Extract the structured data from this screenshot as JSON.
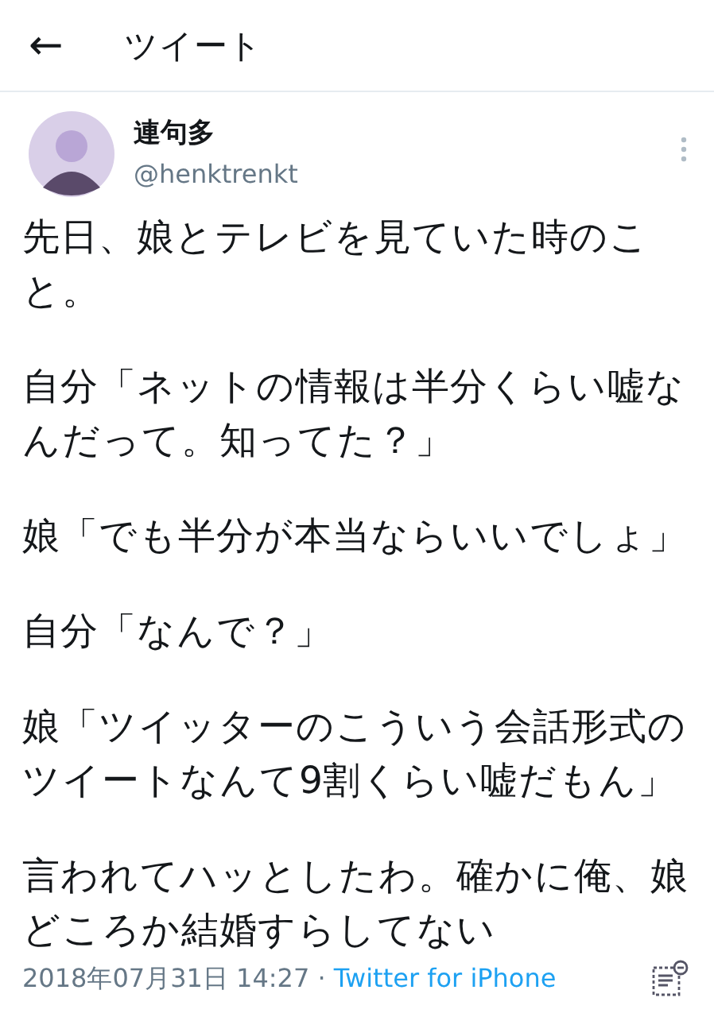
{
  "header": {
    "back": "←",
    "title": "ツイート"
  },
  "tweet": {
    "author": {
      "name": "連句多",
      "handle": "@henktrenkt"
    },
    "paragraphs": [
      "先日、娘とテレビを見ていた時のこと。",
      "自分「ネットの情報は半分くらい嘘なんだって。知ってた？」",
      "娘「でも半分が本当ならいいでしょ」",
      "自分「なんで？」",
      "娘「ツイッターのこういう会話形式のツイートなんて9割くらい嘘だもん」",
      "言われてハッとしたわ。確かに俺、娘どころか結婚すらしてない"
    ],
    "timestamp": "2018年07月31日 14:27 · ",
    "source": "Twitter for iPhone"
  }
}
